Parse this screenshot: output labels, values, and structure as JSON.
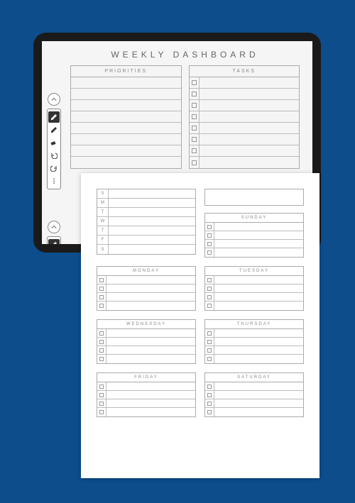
{
  "page1": {
    "title": "WEEKLY DASHBOARD",
    "priorities_label": "PRIORITIES",
    "tasks_label": "TASKS",
    "priority_lines": 8,
    "task_lines": 8
  },
  "page2": {
    "habit_days": [
      "S",
      "M",
      "T",
      "W",
      "T",
      "F",
      "S"
    ],
    "days": {
      "sunday": "SUNDAY",
      "monday": "MONDAY",
      "tuesday": "TUESDAY",
      "wednesday": "WEDNESDAY",
      "thursday": "THURSDAY",
      "friday": "FRIDAY",
      "saturday": "SATURDAY"
    },
    "day_lines": 4
  },
  "toolbar": {
    "items": [
      "pen",
      "highlighter",
      "eraser",
      "undo",
      "redo",
      "more"
    ]
  }
}
